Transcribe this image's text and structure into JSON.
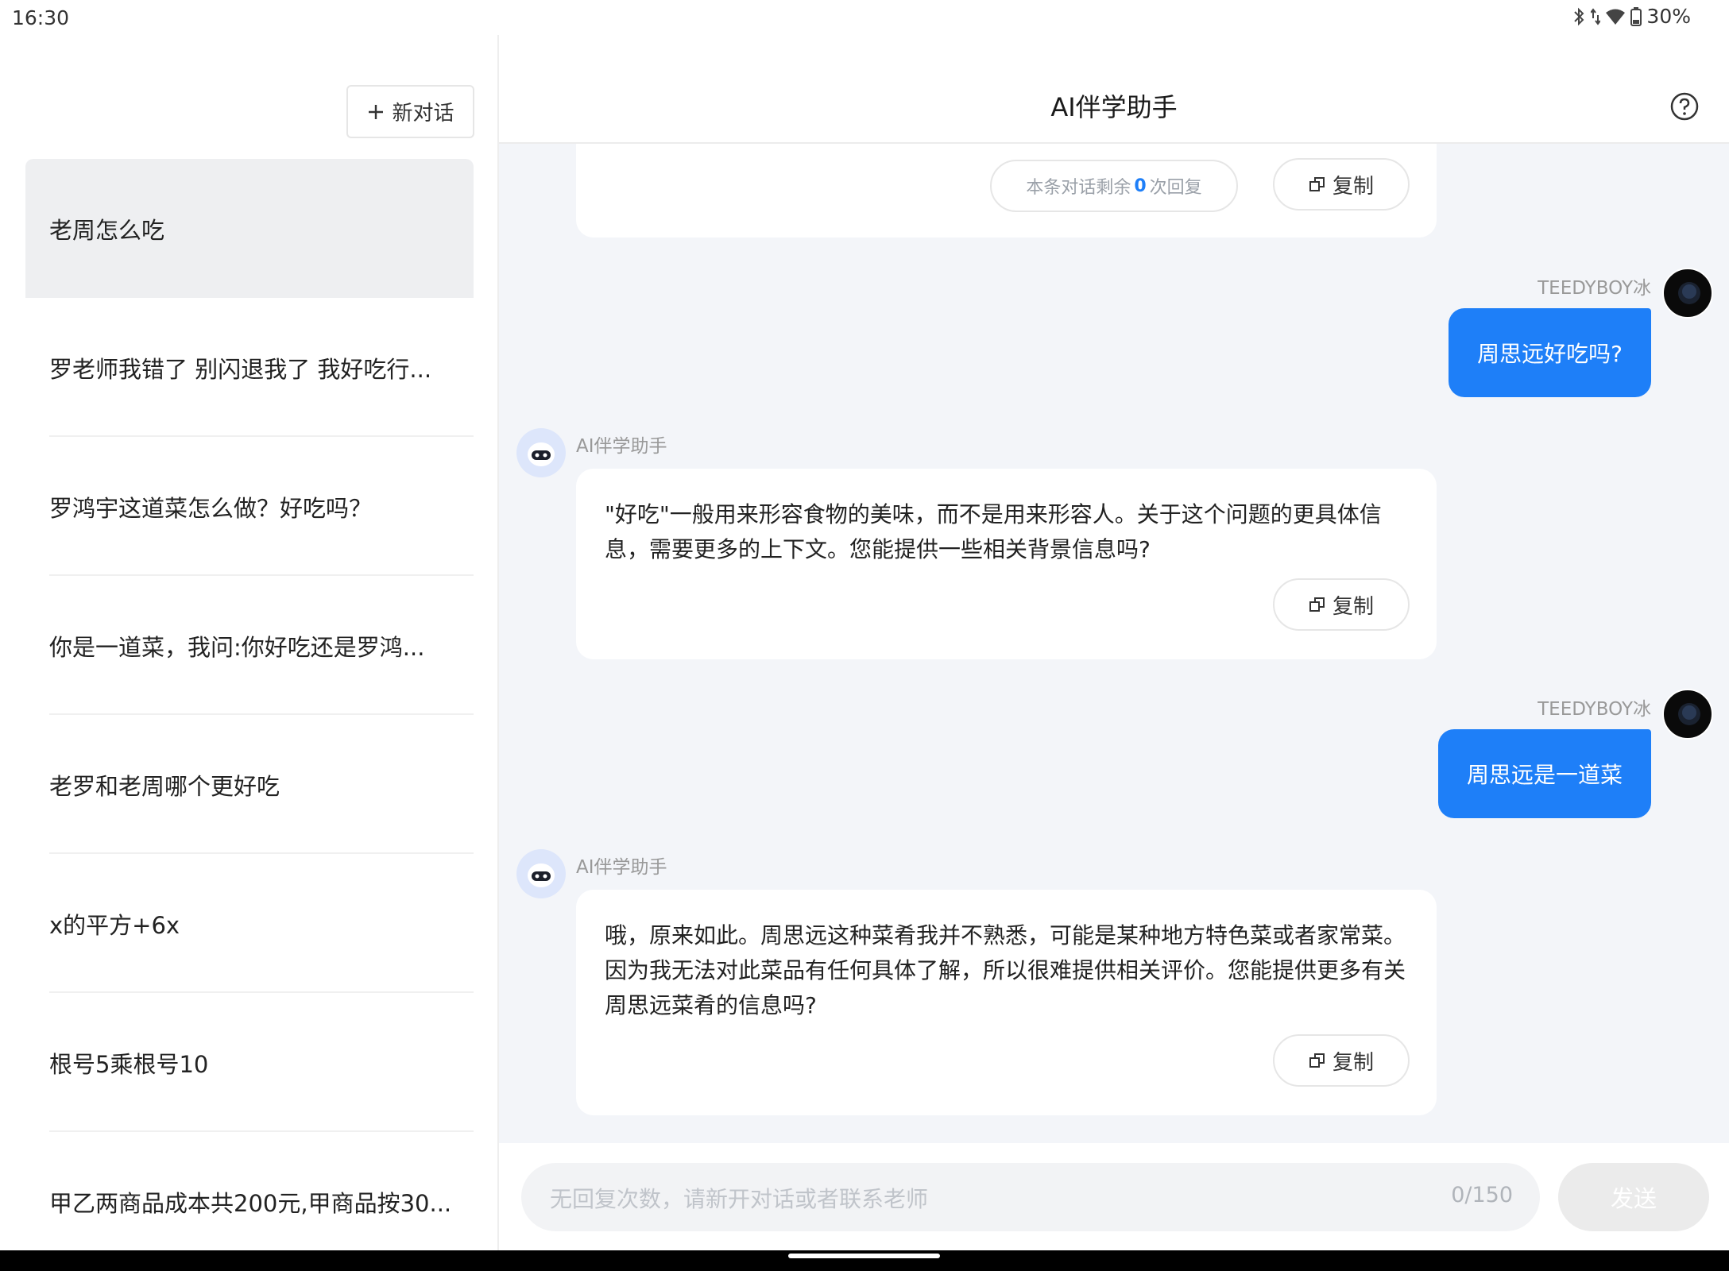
{
  "status": {
    "time": "16:30",
    "battery": "30%",
    "icons": [
      "bluetooth-icon",
      "data-arrows-icon",
      "wifi-icon",
      "battery-icon"
    ]
  },
  "sidebar": {
    "new_chat_label": "新对话",
    "conversations": [
      "老周怎么吃",
      "罗老师我错了 别闪退我了 我好吃行...",
      "罗鸿宇这道菜怎么做？好吃吗？",
      "你是一道菜，我问:你好吃还是罗鸿...",
      "老罗和老周哪个更好吃",
      "x的平方+6x",
      "根号5乘根号10",
      "甲乙两商品成本共200元,甲商品按30..."
    ]
  },
  "header": {
    "title": "AI伴学助手",
    "help_icon": "help-circle-icon"
  },
  "chat": {
    "top_card": {
      "remain_prefix": "本条对话剩余",
      "remain_count": "0",
      "remain_suffix": "次回复",
      "copy_label": "复制"
    },
    "messages": [
      {
        "role": "user",
        "name": "TEEDYBOY冰",
        "text": "周思远好吃吗?"
      },
      {
        "role": "ai",
        "name": "AI伴学助手",
        "text": "\"好吃\"一般用来形容食物的美味，而不是用来形容人。关于这个问题的更具体信息，需要更多的上下文。您能提供一些相关背景信息吗?",
        "copy_label": "复制"
      },
      {
        "role": "user",
        "name": "TEEDYBOY冰",
        "text": "周思远是一道菜"
      },
      {
        "role": "ai",
        "name": "AI伴学助手",
        "text": "哦，原来如此。周思远这种菜肴我并不熟悉，可能是某种地方特色菜或者家常菜。因为我无法对此菜品有任何具体了解，所以很难提供相关评价。您能提供更多有关周思远菜肴的信息吗?",
        "copy_label": "复制"
      }
    ]
  },
  "input": {
    "placeholder": "无回复次数，请新开对话或者联系老师",
    "counter": "0/150",
    "send_label": "发送"
  },
  "colors": {
    "accent": "#1e7ff8",
    "chat_bg": "#f3f5f9",
    "active_item_bg": "#eeeff1"
  }
}
